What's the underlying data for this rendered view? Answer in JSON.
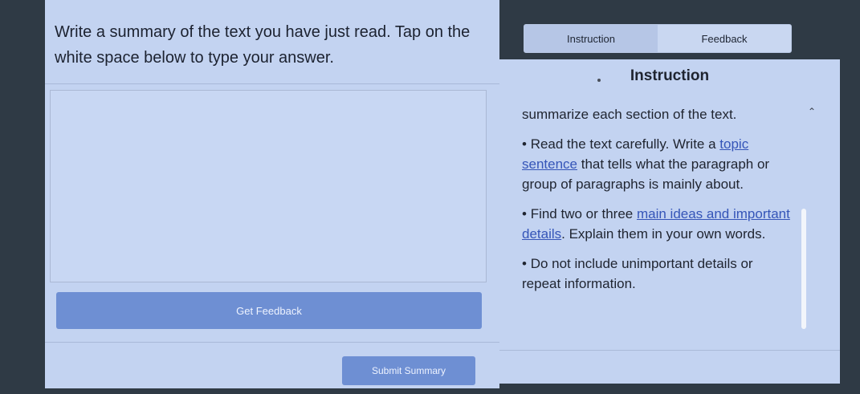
{
  "prompt": {
    "text": "Write a summary of the text you have just read. Tap on the white space below to type your answer."
  },
  "answer": {
    "value": "",
    "placeholder": ""
  },
  "buttons": {
    "get_feedback": "Get Feedback",
    "submit_summary": "Submit Summary"
  },
  "tabs": [
    {
      "label": "Instruction",
      "active": true
    },
    {
      "label": "Feedback",
      "active": false
    }
  ],
  "instruction": {
    "heading": "Instruction",
    "intro": "summarize each section of the text.",
    "bullets": [
      {
        "pre": "Read the text carefully. Write a ",
        "link": "topic sentence",
        "post": " that tells what the paragraph or group of paragraphs is mainly about."
      },
      {
        "pre": "Find two or three ",
        "link": "main ideas and important details",
        "post": ". Explain them in your own words."
      },
      {
        "pre": "Do not include unimportant details or repeat information.",
        "link": "",
        "post": ""
      }
    ]
  },
  "icons": {
    "collapse": "caret-up-icon"
  },
  "colors": {
    "panel": "#c3d3f1",
    "button": "#6e8fd3",
    "link": "#3555b8",
    "background": "#2f3a45"
  }
}
